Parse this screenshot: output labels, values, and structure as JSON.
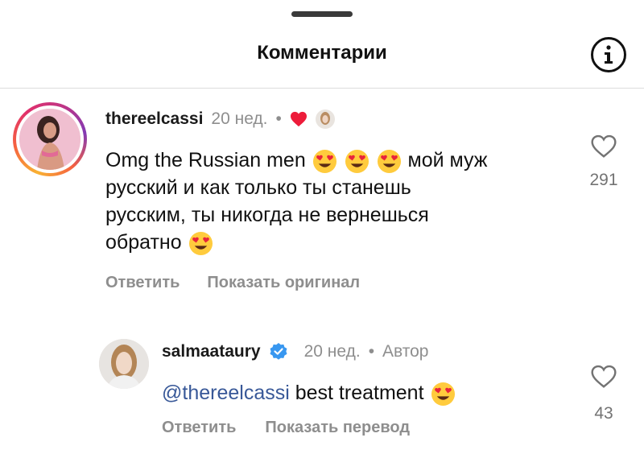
{
  "header": {
    "title": "Комментарии"
  },
  "comments": [
    {
      "username": "thereelcassi",
      "time": "20 нед.",
      "text_parts": [
        "Omg the Russian men",
        "мой муж",
        "русский и как только ты станешь",
        "русским, ты никогда не вернешься",
        "обратно"
      ],
      "likes": "291",
      "actions": [
        "Ответить",
        "Показать оригинал"
      ]
    },
    {
      "username": "salmaataury",
      "time": "20 нед.",
      "author_label": "Автор",
      "mention": "@thereelcassi",
      "text": "best treatment",
      "likes": "43",
      "actions": [
        "Ответить",
        "Показать перевод"
      ]
    }
  ],
  "colors": {
    "verified": "#3897f0",
    "liked_heart": "#ed1c3a",
    "mention": "#385898"
  }
}
